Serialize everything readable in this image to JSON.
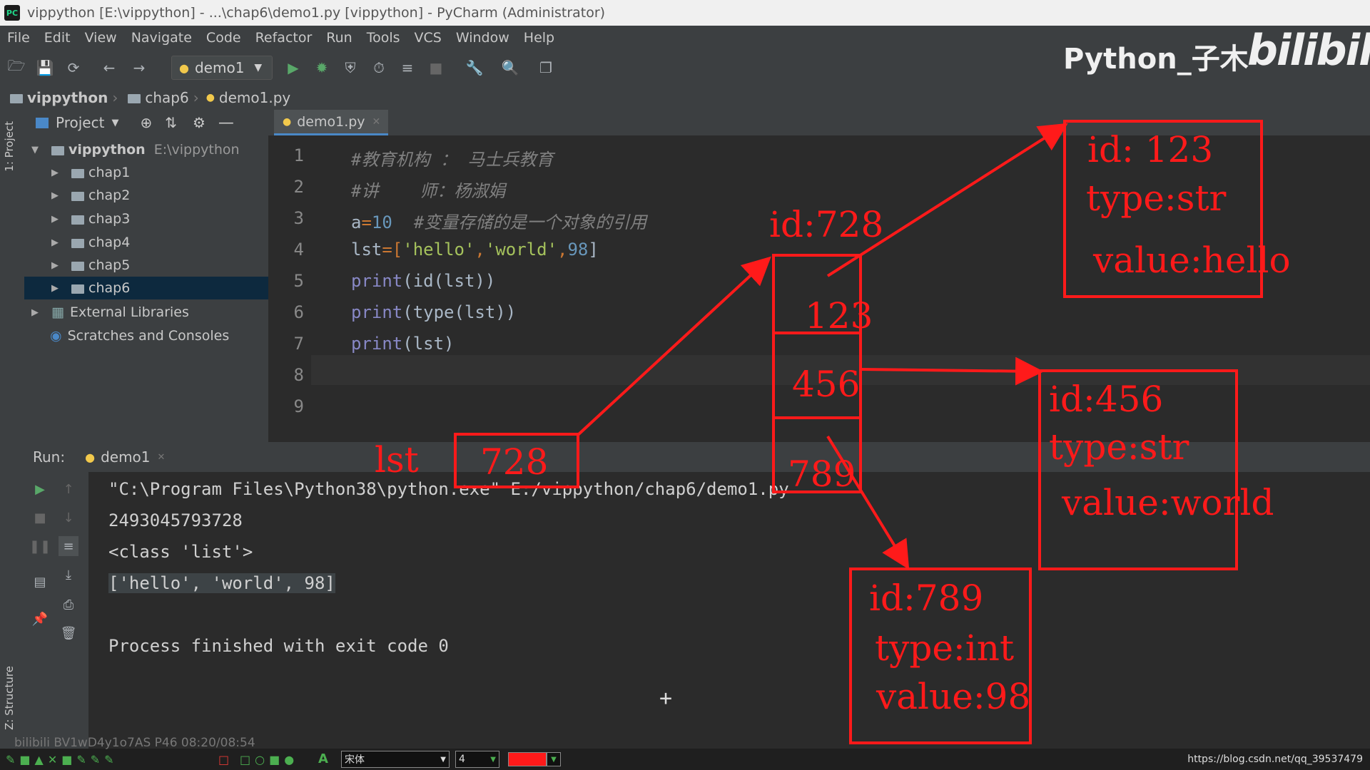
{
  "window": {
    "title": "vippython [E:\\vippython] - ...\\chap6\\demo1.py [vippython] - PyCharm (Administrator)",
    "app_icon": "PC"
  },
  "menu": [
    "File",
    "Edit",
    "View",
    "Navigate",
    "Code",
    "Refactor",
    "Run",
    "Tools",
    "VCS",
    "Window",
    "Help"
  ],
  "toolbar": {
    "run_config": "demo1"
  },
  "breadcrumb": [
    "vippython",
    "chap6",
    "demo1.py"
  ],
  "left_strip": {
    "project_tab": "1: Project",
    "structure_tab": "Z: Structure"
  },
  "project_panel": {
    "title": "Project",
    "root": {
      "name": "vippython",
      "path": "E:\\vippython"
    },
    "folders": [
      "chap1",
      "chap2",
      "chap3",
      "chap4",
      "chap5",
      "chap6"
    ],
    "selected": "chap6",
    "external": "External Libraries",
    "scratches": "Scratches and Consoles"
  },
  "editor": {
    "tab": "demo1.py",
    "line_numbers": [
      "1",
      "2",
      "3",
      "4",
      "5",
      "6",
      "7",
      "8",
      "9"
    ],
    "lines": {
      "l1": "#教育机构 ： 马士兵教育",
      "l2": "#讲    师：杨淑娟",
      "l3_var": "a",
      "l3_eq": "=",
      "l3_num": "10",
      "l3_comment": "#变量存储的是一个对象的引用",
      "l4_var": "lst",
      "l4_eq": "=[",
      "l4_s1": "'hello'",
      "l4_c1": ",",
      "l4_s2": "'world'",
      "l4_c2": ",",
      "l4_num": "98",
      "l4_end": "]",
      "l5_fn": "print",
      "l5_rest": "(id(lst))",
      "l6_fn": "print",
      "l6_rest": "(type(lst))",
      "l7_fn": "print",
      "l7_rest": "(lst)"
    }
  },
  "run": {
    "label": "Run:",
    "tab": "demo1",
    "output": [
      "\"C:\\Program Files\\Python38\\python.exe\" E:/vippython/chap6/demo1.py",
      "2493045793728",
      "<class 'list'>",
      "['hello', 'world', 98]",
      "",
      "Process finished with exit code 0"
    ]
  },
  "watermark": {
    "text": "Python_子木",
    "logo": "bilibili"
  },
  "annotations": {
    "lst_label": "lst",
    "lst_value": "728",
    "list_id": "id:728",
    "cells": [
      "123",
      "456",
      "789"
    ],
    "obj1": {
      "id": "id: 123",
      "type": "type:str",
      "value": "value:hello"
    },
    "obj2": {
      "id": "id:456",
      "type": "type:str",
      "value": "value:world"
    },
    "obj3": {
      "id": "id:789",
      "type": "type:int",
      "value": "value:98"
    }
  },
  "statusbar": {
    "overlay": "bilibili BV1wD4y1o7AS P46 08:20/08:54",
    "font_select": "宋体",
    "size_select": "4",
    "url": "https://blog.csdn.net/qq_39537479"
  },
  "colors": {
    "annotation": "#ff1a1a",
    "selection": "#0d293e",
    "ide_bg": "#2b2b2b",
    "panel_bg": "#3c3f41"
  }
}
